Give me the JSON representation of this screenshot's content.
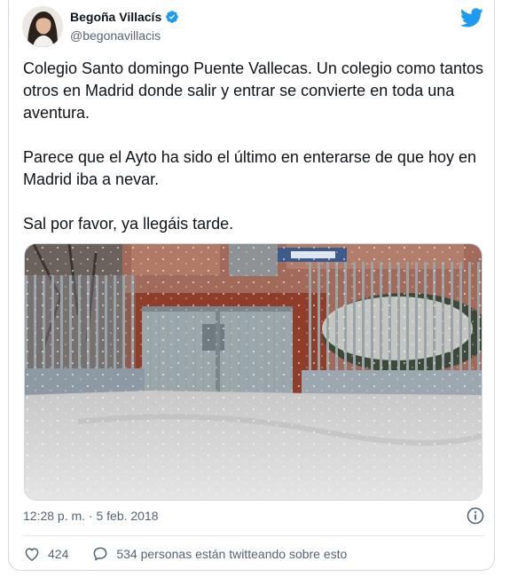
{
  "user": {
    "name": "Begoña Villacís",
    "handle": "@begonavillacis",
    "verified": true
  },
  "tweet": {
    "paragraphs": [
      "Colegio Santo domingo Puente Vallecas. Un colegio como tantos otros en Madrid donde salir y entrar se convierte en toda una aventura.",
      "Parece que el Ayto ha sido el último en enterarse de que hoy en Madrid iba a nevar.",
      "Sal por favor, ya llegáis tarde."
    ],
    "timestamp": "12:28 p. m. · 5 feb. 2018"
  },
  "actions": {
    "likes": "424",
    "talking": "534 personas están twitteando sobre esto"
  },
  "colors": {
    "twitter_blue": "#1d9bf0",
    "text": "#0f1419",
    "secondary": "#536471"
  },
  "icons": [
    "verified-badge-icon",
    "twitter-bird-icon",
    "info-icon",
    "heart-icon",
    "speech-bubble-icon"
  ]
}
